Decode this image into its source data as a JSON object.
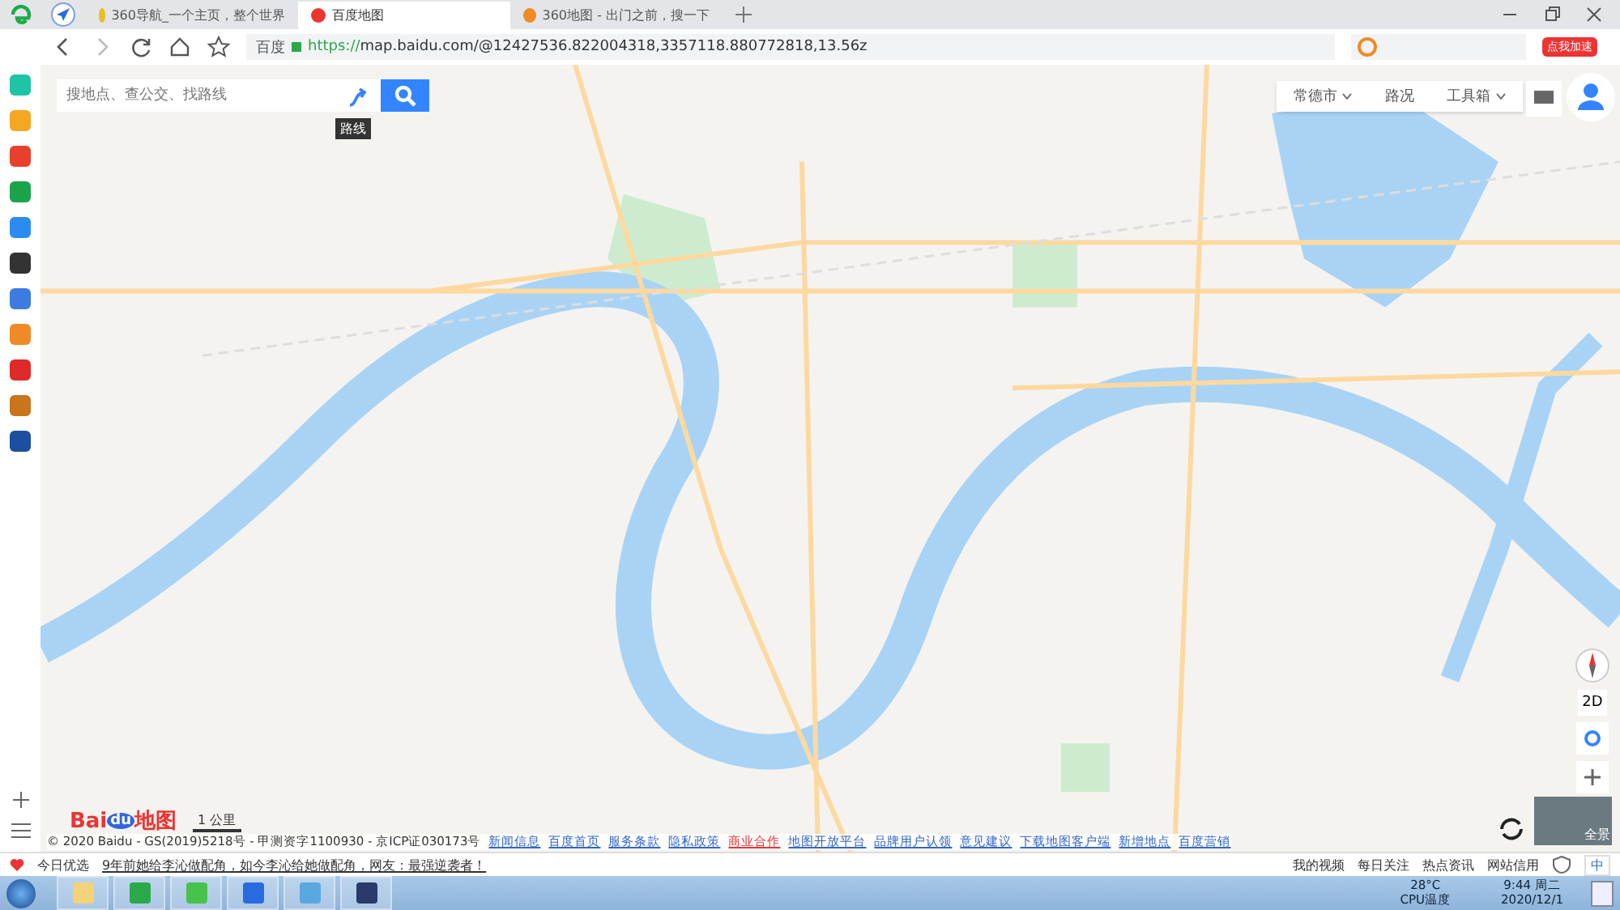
{
  "browser": {
    "tabs": [
      {
        "title": "360导航_一个主页，整个世界",
        "selected": false
      },
      {
        "title": "百度地图",
        "selected": true
      },
      {
        "title": "360地图 - 出门之前，搜一下",
        "selected": false
      }
    ],
    "address": {
      "site": "百度",
      "scheme": "https://",
      "host": "map.baidu.com",
      "path": "/@12427536.822004318,3357118.880772818,13.56z"
    },
    "promo_badge": "点我加速"
  },
  "map": {
    "search": {
      "placeholder": "搜地点、查公交、找路线"
    },
    "route_tooltip": "路线",
    "city": "常德市",
    "traffic": "路况",
    "toolbox": "工具箱",
    "view_mode": "2D",
    "logo": {
      "part_1": "Bai",
      "part_2": "du",
      "part_3": "地图"
    },
    "scale": "1 公里",
    "copyright": "© 2020 Baidu - GS(2019)5218号 - 甲测资字1100930 - 京ICP证030173号",
    "links": [
      {
        "label": "新闻信息",
        "hot": false
      },
      {
        "label": "百度首页",
        "hot": false
      },
      {
        "label": "服务条款",
        "hot": false
      },
      {
        "label": "隐私政策",
        "hot": false
      },
      {
        "label": "商业合作",
        "hot": true
      },
      {
        "label": "地图开放平台",
        "hot": false
      },
      {
        "label": "品牌用户认领",
        "hot": false
      },
      {
        "label": "意见建议",
        "hot": false
      },
      {
        "label": "下载地图客户端",
        "hot": false
      },
      {
        "label": "新增地点",
        "hot": false
      },
      {
        "label": "百度营销",
        "hot": false
      }
    ],
    "street_view": "全景"
  },
  "status_bar": {
    "today": "今日优选",
    "headline": "9年前她给李沁做配角，如今李沁给她做配角，网友：最强逆袭者！",
    "items": [
      "我的视频",
      "每日关注",
      "热点资讯",
      "网站信用"
    ],
    "ime": "中"
  },
  "taskbar": {
    "temperature": "28°C",
    "cpu_label": "CPU温度",
    "time": "9:44 周二",
    "date": "2020/12/1"
  }
}
